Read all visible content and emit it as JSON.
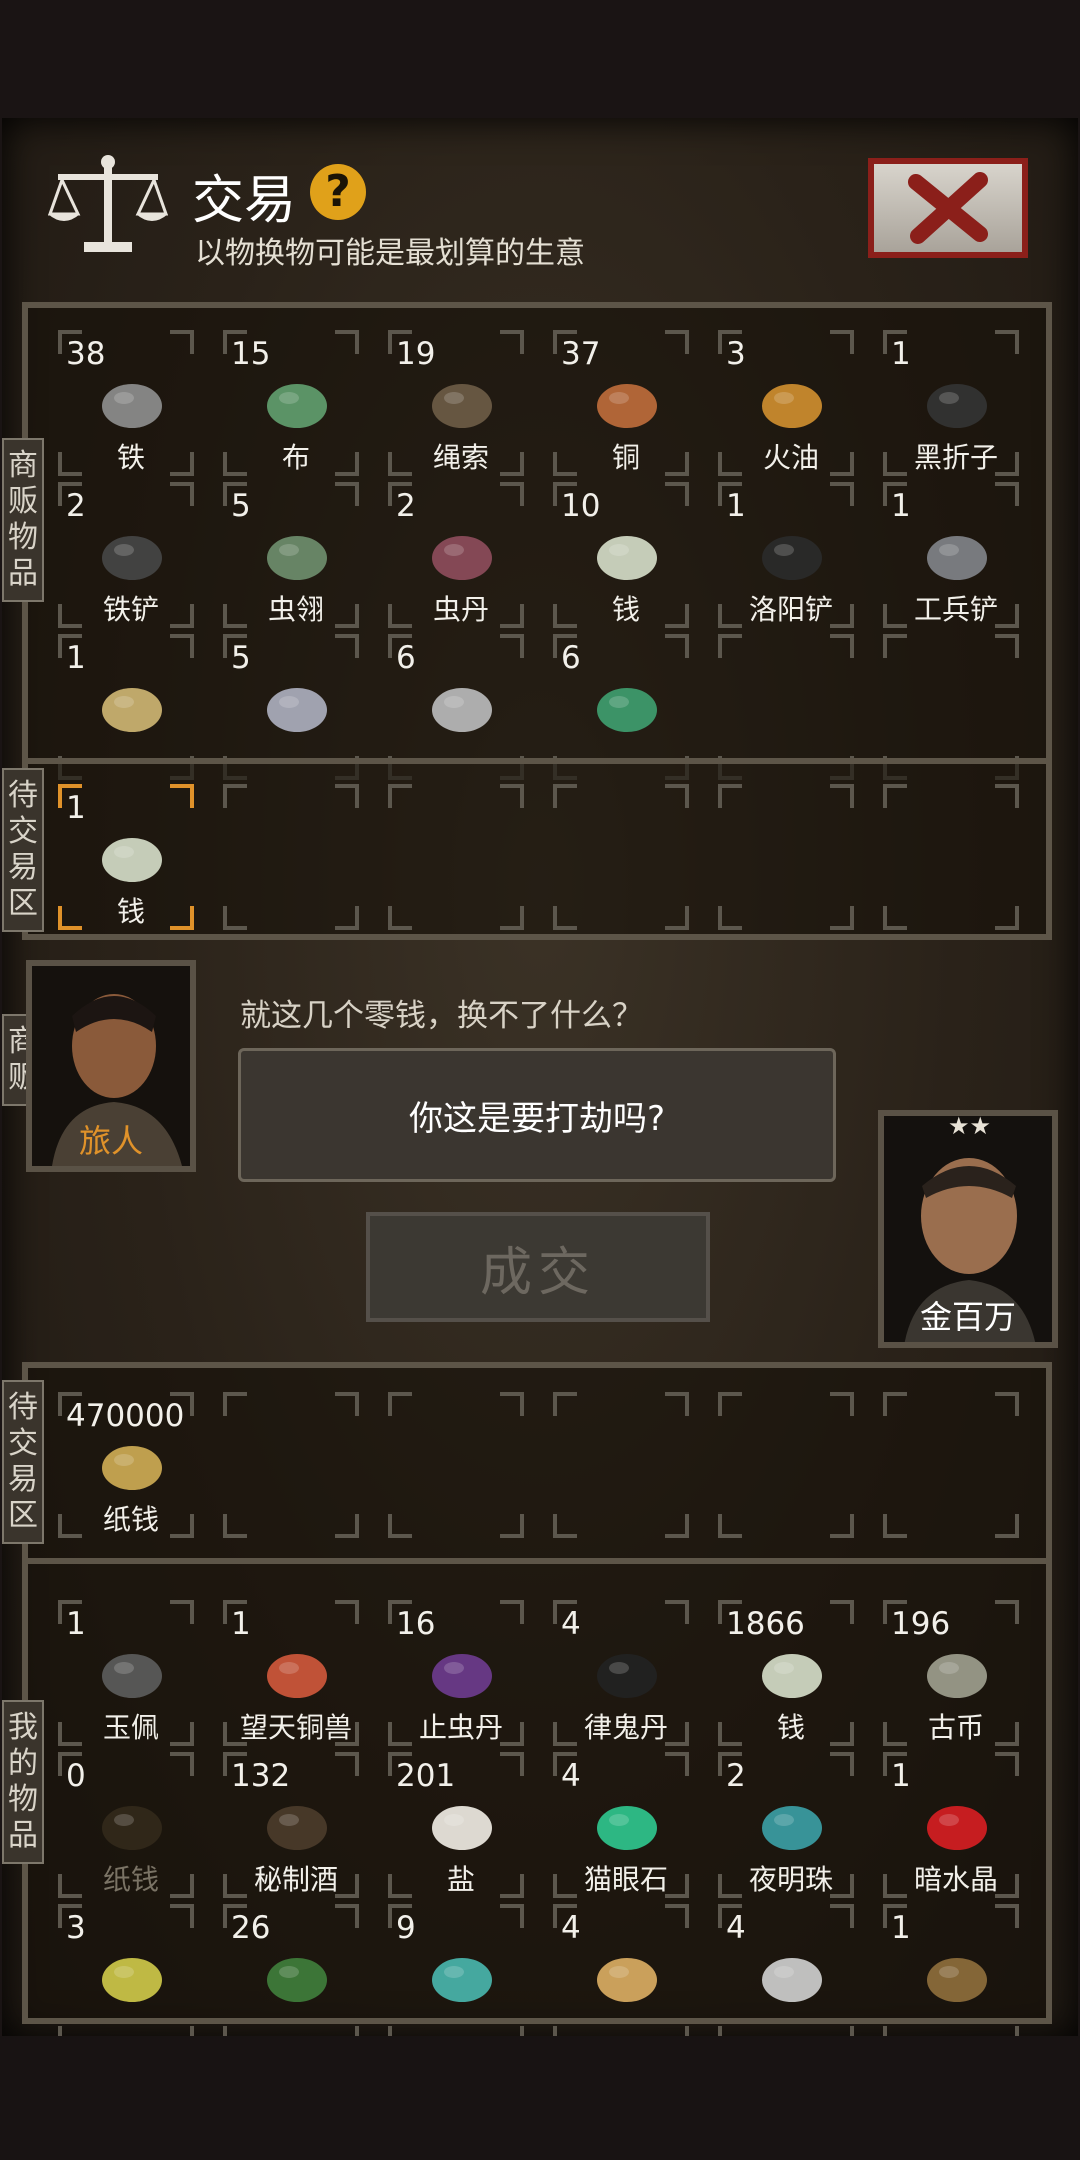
{
  "header": {
    "title": "交易",
    "subtitle": "以物换物可能是最划算的生意",
    "help_glyph": "?"
  },
  "labels": {
    "merchant_goods": [
      "商",
      "贩",
      "物",
      "品"
    ],
    "pending_top": [
      "待",
      "交",
      "易",
      "区"
    ],
    "merchant": [
      "商",
      "贩"
    ],
    "pending_bottom": [
      "待",
      "交",
      "易",
      "区"
    ],
    "my_goods": [
      "我",
      "的",
      "物",
      "品"
    ]
  },
  "merchant_items": [
    {
      "count": "38",
      "name": "铁",
      "icon": "iron-ore-icon",
      "color": "#8a8a8a"
    },
    {
      "count": "15",
      "name": "布",
      "icon": "cloth-icon",
      "color": "#5f9a6c"
    },
    {
      "count": "19",
      "name": "绳索",
      "icon": "rope-icon",
      "color": "#6a5a44"
    },
    {
      "count": "37",
      "name": "铜",
      "icon": "copper-ore-icon",
      "color": "#b8693a"
    },
    {
      "count": "3",
      "name": "火油",
      "icon": "oil-bottle-icon",
      "color": "#c98a2e"
    },
    {
      "count": "1",
      "name": "黑折子",
      "icon": "black-staff-icon",
      "color": "#333"
    },
    {
      "count": "2",
      "name": "铁铲",
      "icon": "iron-shovel-icon",
      "color": "#444"
    },
    {
      "count": "5",
      "name": "虫翎",
      "icon": "insect-feather-icon",
      "color": "#6c8a6a"
    },
    {
      "count": "2",
      "name": "虫丹",
      "icon": "insect-pill-icon",
      "color": "#8a4b5a"
    },
    {
      "count": "10",
      "name": "钱",
      "icon": "money-stack-icon",
      "color": "#cfd6c2"
    },
    {
      "count": "1",
      "name": "洛阳铲",
      "icon": "luoyang-shovel-icon",
      "color": "#2a2a2a"
    },
    {
      "count": "1",
      "name": "工兵铲",
      "icon": "army-shovel-icon",
      "color": "#7d8085"
    },
    {
      "count": "1",
      "name": "",
      "icon": "tweezers-icon",
      "color": "#c8b070"
    },
    {
      "count": "5",
      "name": "",
      "icon": "crystal-ore-icon",
      "color": "#a8aab8"
    },
    {
      "count": "6",
      "name": "",
      "icon": "silver-stone-icon",
      "color": "#b5b5b5"
    },
    {
      "count": "6",
      "name": "",
      "icon": "green-stone-icon",
      "color": "#3e9a6b"
    }
  ],
  "pending_merchant": [
    {
      "count": "1",
      "name": "钱",
      "icon": "money-stack-icon",
      "color": "#cfd6c2"
    }
  ],
  "npc": {
    "left_name": "旅人",
    "right_name": "金百万",
    "stars": "★★",
    "speech": "就这几个零钱，换不了什么？",
    "bubble": "你这是要打劫吗?"
  },
  "deal_button": "成交",
  "pending_mine": [
    {
      "count": "470000",
      "name": "纸钱",
      "icon": "paper-money-icon",
      "color": "#c8a652"
    }
  ],
  "my_items": [
    {
      "count": "1",
      "name": "玉佩",
      "icon": "jade-pendant-icon",
      "color": "#5a5a5a"
    },
    {
      "count": "1",
      "name": "望天铜兽",
      "icon": "copper-beast-icon",
      "color": "#c9553a"
    },
    {
      "count": "16",
      "name": "止虫丹",
      "icon": "purple-pills-icon",
      "color": "#6a3a8a"
    },
    {
      "count": "4",
      "name": "律鬼丹",
      "icon": "black-pills-icon",
      "color": "#222"
    },
    {
      "count": "1866",
      "name": "钱",
      "icon": "money-stack-icon",
      "color": "#cfd6c2"
    },
    {
      "count": "196",
      "name": "古币",
      "icon": "ancient-coin-icon",
      "color": "#9a9a8a"
    },
    {
      "count": "0",
      "name": "纸钱",
      "icon": "paper-money-icon",
      "color": "#5a4a30",
      "dim": true
    },
    {
      "count": "132",
      "name": "秘制酒",
      "icon": "wine-jar-icon",
      "color": "#4a3a2a"
    },
    {
      "count": "201",
      "name": "盐",
      "icon": "salt-pile-icon",
      "color": "#e8e4dc"
    },
    {
      "count": "4",
      "name": "猫眼石",
      "icon": "cat-eye-stone-icon",
      "color": "#2ec08a"
    },
    {
      "count": "2",
      "name": "夜明珠",
      "icon": "night-pearl-icon",
      "color": "#3a9aa0"
    },
    {
      "count": "1",
      "name": "暗水晶",
      "icon": "dark-crystal-icon",
      "color": "#d01e22"
    },
    {
      "count": "3",
      "name": "",
      "icon": "yellow-gem-icon",
      "color": "#c8c248"
    },
    {
      "count": "26",
      "name": "",
      "icon": "green-leaf-icon",
      "color": "#3e7a3a"
    },
    {
      "count": "9",
      "name": "",
      "icon": "turquoise-icon",
      "color": "#48b0a8"
    },
    {
      "count": "4",
      "name": "",
      "icon": "gold-ingot-icon",
      "color": "#d4a860"
    },
    {
      "count": "4",
      "name": "",
      "icon": "silver-ingot-icon",
      "color": "#c8c8c8"
    },
    {
      "count": "1",
      "name": "",
      "icon": "treasure-chest-icon",
      "color": "#8a6a3a"
    }
  ]
}
